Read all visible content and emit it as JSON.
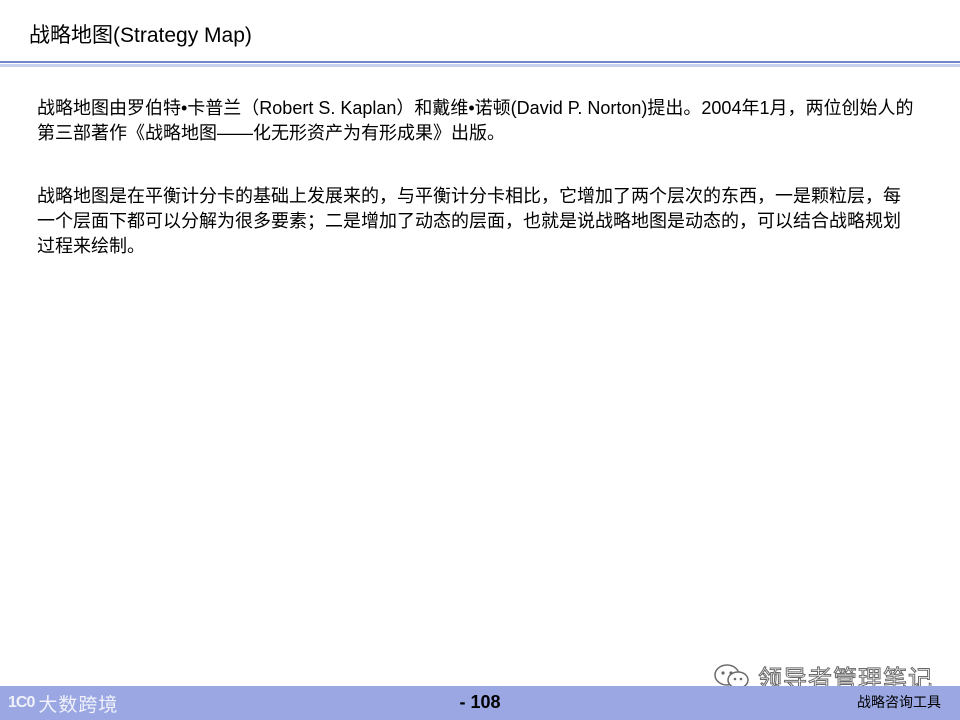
{
  "slide": {
    "title": "战略地图(Strategy Map)"
  },
  "body": {
    "paragraphs": [
      "战略地图由罗伯特•卡普兰（Robert  S. Kaplan）和戴维•诺顿(David  P. Norton)提出。2004年1月，两位创始人的第三部著作《战略地图——化无形资产为有形成果》出版。",
      "战略地图是在平衡计分卡的基础上发展来的，与平衡计分卡相比，它增加了两个层次的东西，一是颗粒层，每一个层面下都可以分解为很多要素；二是增加了动态的层面，也就是说战略地图是动态的，可以结合战略规划过程来绘制。"
    ]
  },
  "footer": {
    "page_number": "- 108",
    "right_label": "战略咨询工具",
    "logo_mark": "1C0",
    "logo_name": "大数跨境",
    "bar_color": "#9aa7e3"
  },
  "watermark": {
    "label": "领导者管理笔记",
    "icon": "wechat-icon"
  },
  "colors": {
    "title_rule": "#6f86c8",
    "title_rule_light": "#c9d2ee"
  }
}
